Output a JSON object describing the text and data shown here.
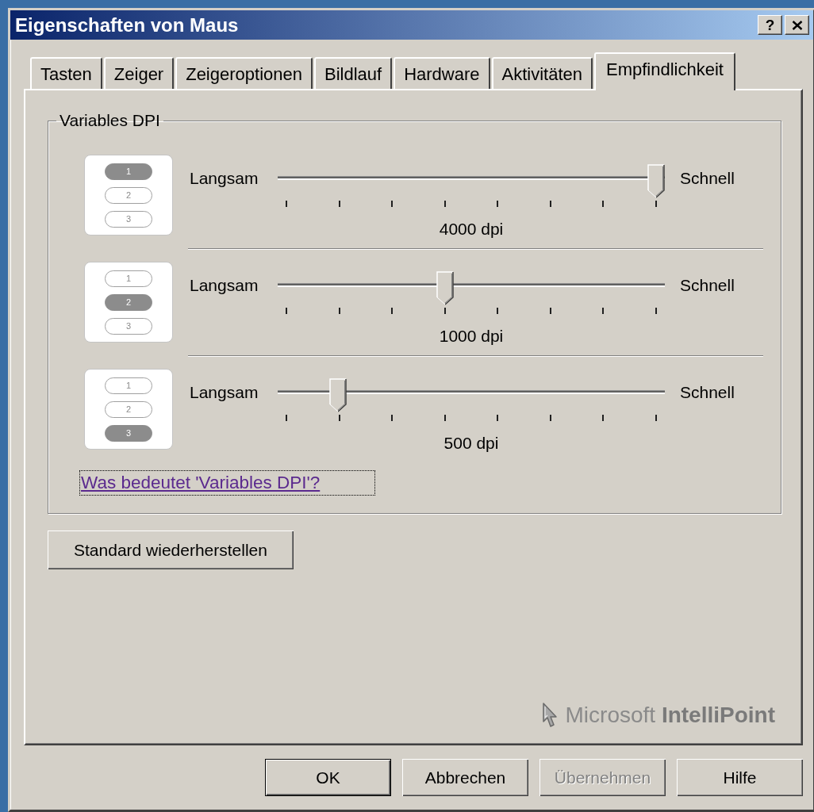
{
  "window": {
    "title": "Eigenschaften von Maus",
    "help_button": "?"
  },
  "tabs": [
    {
      "label": "Tasten",
      "selected": false
    },
    {
      "label": "Zeiger",
      "selected": false
    },
    {
      "label": "Zeigeroptionen",
      "selected": false
    },
    {
      "label": "Bildlauf",
      "selected": false
    },
    {
      "label": "Hardware",
      "selected": false
    },
    {
      "label": "Aktivitäten",
      "selected": false
    },
    {
      "label": "Empfindlichkeit",
      "selected": true
    }
  ],
  "group": {
    "title": "Variables DPI",
    "dpi_rows": [
      {
        "indicators": [
          {
            "label": "1",
            "selected": true
          },
          {
            "label": "2",
            "selected": false
          },
          {
            "label": "3",
            "selected": false
          }
        ],
        "slow_label": "Langsam",
        "fast_label": "Schnell",
        "level": 1,
        "reading": "4000 dpi"
      },
      {
        "indicators": [
          {
            "label": "1",
            "selected": false
          },
          {
            "label": "2",
            "selected": true
          },
          {
            "label": "3",
            "selected": false
          }
        ],
        "slow_label": "Langsam",
        "fast_label": "Schnell",
        "level": 0.43,
        "reading": "1000 dpi"
      },
      {
        "indicators": [
          {
            "label": "1",
            "selected": false
          },
          {
            "label": "2",
            "selected": false
          },
          {
            "label": "3",
            "selected": true
          }
        ],
        "slow_label": "Langsam",
        "fast_label": "Schnell",
        "level": 0.14,
        "reading": "500 dpi"
      }
    ],
    "help_link": {
      "text": "Was bedeutet 'Variables DPI'?",
      "focused": true
    }
  },
  "restore_button": "Standard wiederherstellen",
  "logo": "Microsoft **IntelliPoint**",
  "buttons": [
    {
      "label": "OK",
      "default": true,
      "disabled": false
    },
    {
      "label": "Abbrechen",
      "default": false,
      "disabled": false
    },
    {
      "label": "Übernehmen",
      "default": false,
      "disabled": true
    },
    {
      "label": "Hilfe",
      "default": false,
      "disabled": false
    }
  ]
}
